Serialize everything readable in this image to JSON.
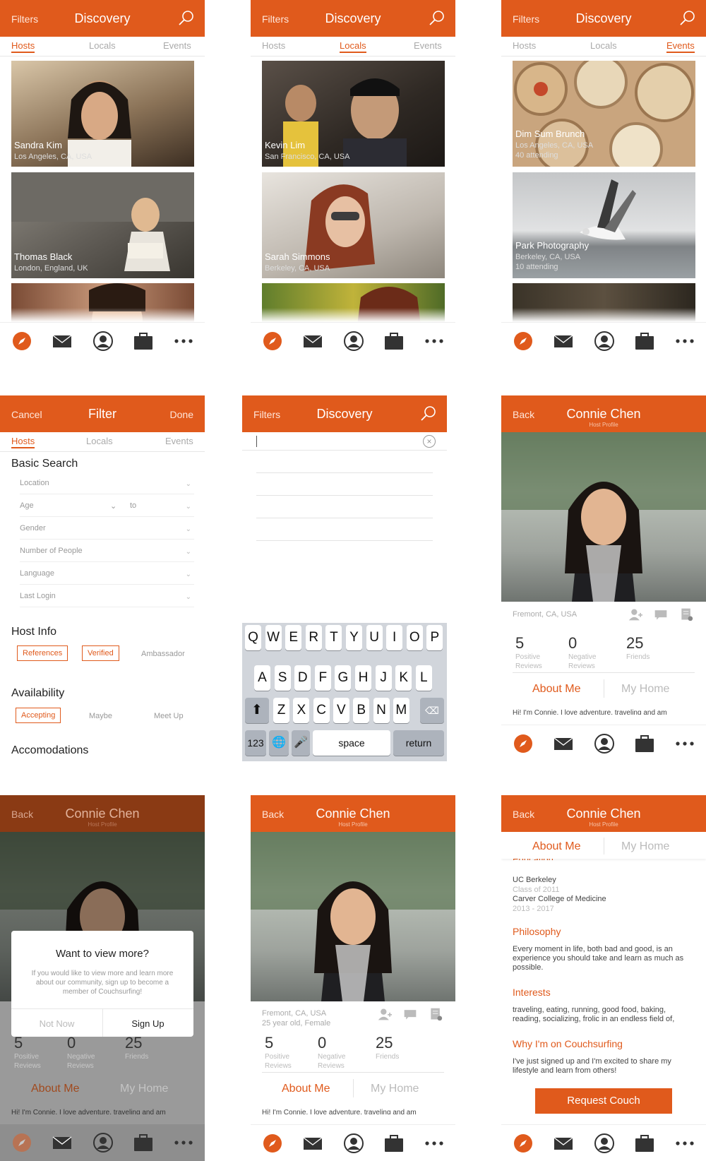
{
  "colors": {
    "accent": "#e05a1c",
    "tint": "#f3c5ae",
    "muted": "#aaaaaa"
  },
  "discovery": {
    "filters_label": "Filters",
    "title": "Discovery",
    "search_icon": "search-icon"
  },
  "tabs": {
    "hosts": "Hosts",
    "locals": "Locals",
    "events": "Events"
  },
  "hosts_list": [
    {
      "name": "Sandra Kim",
      "location": "Los Angeles, CA, USA"
    },
    {
      "name": "Thomas Black",
      "location": "London, England, UK"
    }
  ],
  "locals_list": [
    {
      "name": "Kevin Lim",
      "location": "San Francisco, CA, USA"
    },
    {
      "name": "Sarah Simmons",
      "location": "Berkeley, CA, USA"
    }
  ],
  "events_list": [
    {
      "name": "Dim Sum Brunch",
      "location": "Los Angeles, CA, USA",
      "attending": "40 attending"
    },
    {
      "name": "Park Photography",
      "location": "Berkeley, CA, USA",
      "attending": "10 attending"
    }
  ],
  "tabbar": {
    "icons": [
      "compass-icon",
      "mail-icon",
      "profile-icon",
      "briefcase-icon",
      "more-icon"
    ]
  },
  "filter": {
    "cancel": "Cancel",
    "title": "Filter",
    "done": "Done",
    "basic_search": "Basic Search",
    "fields": {
      "location": "Location",
      "age": "Age",
      "to": "to",
      "gender": "Gender",
      "people": "Number of People",
      "language": "Language",
      "last_login": "Last Login"
    },
    "host_info": "Host Info",
    "host_options": {
      "references": "References",
      "verified": "Verified",
      "ambassador": "Ambassador"
    },
    "availability": "Availability",
    "availability_options": {
      "accepting": "Accepting",
      "maybe": "Maybe",
      "meet_up": "Meet Up"
    },
    "accommodations": "Accomodations"
  },
  "keyboard": {
    "row1": [
      "Q",
      "W",
      "E",
      "R",
      "T",
      "Y",
      "U",
      "I",
      "O",
      "P"
    ],
    "row2": [
      "A",
      "S",
      "D",
      "F",
      "G",
      "H",
      "J",
      "K",
      "L"
    ],
    "row3": [
      "Z",
      "X",
      "C",
      "V",
      "B",
      "N",
      "M"
    ],
    "numbers": "123",
    "space": "space",
    "return": "return"
  },
  "profile": {
    "back": "Back",
    "name": "Connie Chen",
    "subtitle": "Host Profile",
    "location": "Fremont, CA, USA",
    "age_gender": "25 year old, Female",
    "stats": [
      {
        "value": "5",
        "label1": "Positive",
        "label2": "Reviews"
      },
      {
        "value": "0",
        "label1": "Negative",
        "label2": "Reviews"
      },
      {
        "value": "25",
        "label1": "Friends",
        "label2": ""
      }
    ],
    "about_tab": "About Me",
    "home_tab": "My Home",
    "intro": "Hi! I'm Connie. I love adventure, traveling and am"
  },
  "modal": {
    "title": "Want to view more?",
    "body": "If you would like to view more and learn more about our community, sign up to become a member of Couchsurfing!",
    "not_now": "Not Now",
    "sign_up": "Sign Up"
  },
  "about": {
    "education_label": "Education",
    "school1": "UC Berkeley",
    "class1": "Class of 2011",
    "school2": "Carver College of Medicine",
    "years2": "2013 - 2017",
    "philosophy_label": "Philosophy",
    "philosophy": "Every moment in life, both bad and good, is an experience you should take and learn as much as possible.",
    "interests_label": "Interests",
    "interests": "traveling, eating, running, good food, baking, reading, socializing, frolic in an endless field of,",
    "why_label": "Why I'm on Couchsurfing",
    "why": "I've just signed up and I'm excited to share my lifestyle and learn from others!",
    "request": "Request Couch"
  }
}
